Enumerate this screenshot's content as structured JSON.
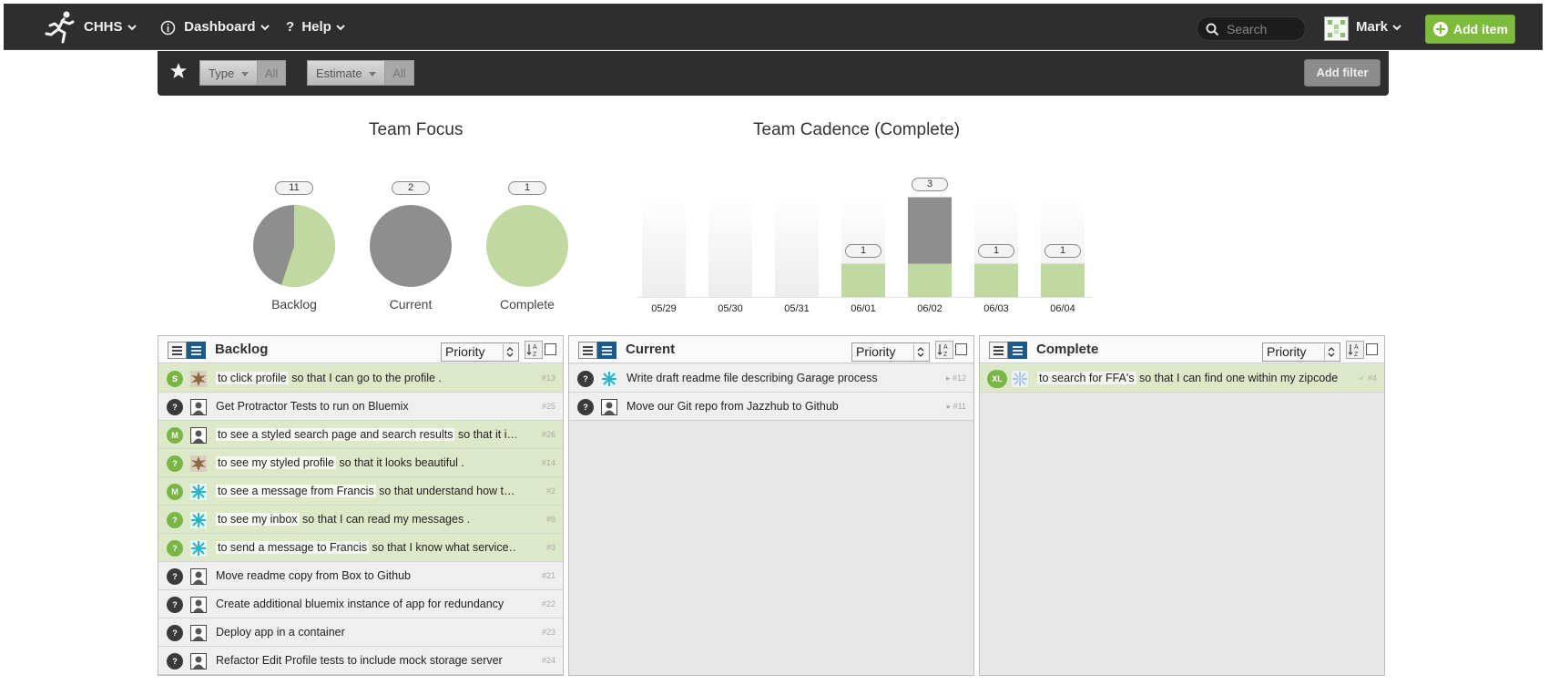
{
  "nav": {
    "project": "CHHS",
    "dashboard": "Dashboard",
    "help": "Help",
    "search_placeholder": "Search",
    "user": "Mark",
    "add_item": "Add item"
  },
  "filters": {
    "type_label": "Type",
    "type_value": "All",
    "estimate_label": "Estimate",
    "estimate_value": "All",
    "add_filter": "Add filter"
  },
  "team_focus": {
    "title": "Team Focus",
    "colors": {
      "incomplete": "#8e8e8e",
      "complete": "#bfd9a1"
    },
    "pies": [
      {
        "label": "Backlog",
        "count": "11",
        "complete_fraction": 0.55
      },
      {
        "label": "Current",
        "count": "2",
        "complete_fraction": 0.0
      },
      {
        "label": "Complete",
        "count": "1",
        "complete_fraction": 1.0
      }
    ]
  },
  "chart_data": {
    "type": "bar",
    "title": "Team Cadence (Complete)",
    "categories": [
      "05/29",
      "05/30",
      "05/31",
      "06/01",
      "06/02",
      "06/03",
      "06/04"
    ],
    "series": [
      {
        "color": "#bfd9a1",
        "values": [
          0,
          0,
          0,
          1,
          1,
          1,
          1
        ]
      },
      {
        "color": "#8e8e8e",
        "values": [
          0,
          0,
          0,
          0,
          2,
          0,
          0
        ]
      }
    ],
    "totals": [
      "",
      "",
      "",
      "1",
      "3",
      "1",
      "1"
    ],
    "ylim": [
      0,
      3
    ]
  },
  "columns": [
    {
      "title": "Backlog",
      "sort": "Priority",
      "items": [
        {
          "kind": "story",
          "size": "S",
          "owner": "brown",
          "role": "to click profile",
          "benefit": "so that I can go to the profile .",
          "num": "#13"
        },
        {
          "kind": "task",
          "size": "?",
          "owner": "person",
          "text": "Get Protractor Tests to run on Bluemix",
          "num": "#25"
        },
        {
          "kind": "story",
          "size": "M",
          "owner": "person",
          "role": "to see a styled search page and search results",
          "benefit": "so that it i…",
          "num": "#26"
        },
        {
          "kind": "story",
          "size": "?",
          "owner": "brown",
          "role": "to see my styled profile",
          "benefit": "so that it looks beautiful .",
          "num": "#14"
        },
        {
          "kind": "story",
          "size": "M",
          "owner": "teal",
          "role": "to see a message from Francis",
          "benefit": "so that understand how t…",
          "num": "#2"
        },
        {
          "kind": "story",
          "size": "?",
          "owner": "teal",
          "role": "to see my inbox",
          "benefit": "so that I can read my messages .",
          "num": "#8"
        },
        {
          "kind": "story",
          "size": "?",
          "owner": "teal",
          "role": "to send a message to Francis",
          "benefit": "so that I know what service…",
          "num": "#3"
        },
        {
          "kind": "task",
          "size": "?",
          "owner": "person",
          "text": "Move readme copy from Box to Github",
          "num": "#21"
        },
        {
          "kind": "task",
          "size": "?",
          "owner": "person",
          "text": "Create additional bluemix instance of app for redundancy",
          "num": "#22"
        },
        {
          "kind": "task",
          "size": "?",
          "owner": "person",
          "text": "Deploy app in a container",
          "num": "#23"
        },
        {
          "kind": "task",
          "size": "?",
          "owner": "person",
          "text": "Refactor Edit Profile tests to include mock storage server",
          "num": "#24"
        }
      ]
    },
    {
      "title": "Current",
      "sort": "Priority",
      "items": [
        {
          "kind": "task",
          "size": "?",
          "owner": "teal",
          "text": "Write draft readme file describing Garage process",
          "num": "▸ #12"
        },
        {
          "kind": "task",
          "size": "?",
          "owner": "person",
          "text": "Move our Git repo from Jazzhub to Github",
          "num": "▸ #11"
        }
      ]
    },
    {
      "title": "Complete",
      "sort": "Priority",
      "items": [
        {
          "kind": "story",
          "size": "XL",
          "owner": "flake",
          "role": "to search for FFA's",
          "benefit": "so that I can find one within my zipcode .",
          "num": "✓ #4"
        }
      ]
    }
  ]
}
